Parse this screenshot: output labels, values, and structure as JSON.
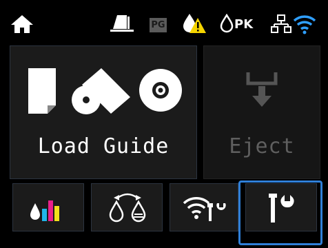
{
  "status_bar": {
    "icons": [
      "home-icon",
      "paper-source-icon",
      "pg-icon",
      "ink-warning-icon",
      "ink-pk-icon",
      "wired-network-icon",
      "wifi-icon"
    ],
    "pg_label": "PG",
    "pk_label": "PK",
    "warning_color": "#f5d400",
    "wifi_color": "#2f9fff"
  },
  "main_tiles": {
    "load_guide": {
      "label": "Load Guide",
      "icons": [
        "cut-sheet-icon",
        "roll-paper-icon",
        "cd-dvd-icon"
      ],
      "enabled": true
    },
    "eject": {
      "label": "Eject",
      "icon": "eject-icon",
      "enabled": false
    }
  },
  "bottom_tiles": [
    {
      "name": "ink-levels",
      "icon": "ink-levels-icon"
    },
    {
      "name": "ink-switch",
      "icon": "ink-switch-icon"
    },
    {
      "name": "network-settings",
      "icon": "wifi-settings-icon"
    },
    {
      "name": "maintenance",
      "icon": "tools-icon",
      "selected": true
    }
  ],
  "colors": {
    "accent": "#2f7fd8",
    "ink": [
      "#111111",
      "#1fb5e8",
      "#e8208a",
      "#f2e01b"
    ]
  }
}
